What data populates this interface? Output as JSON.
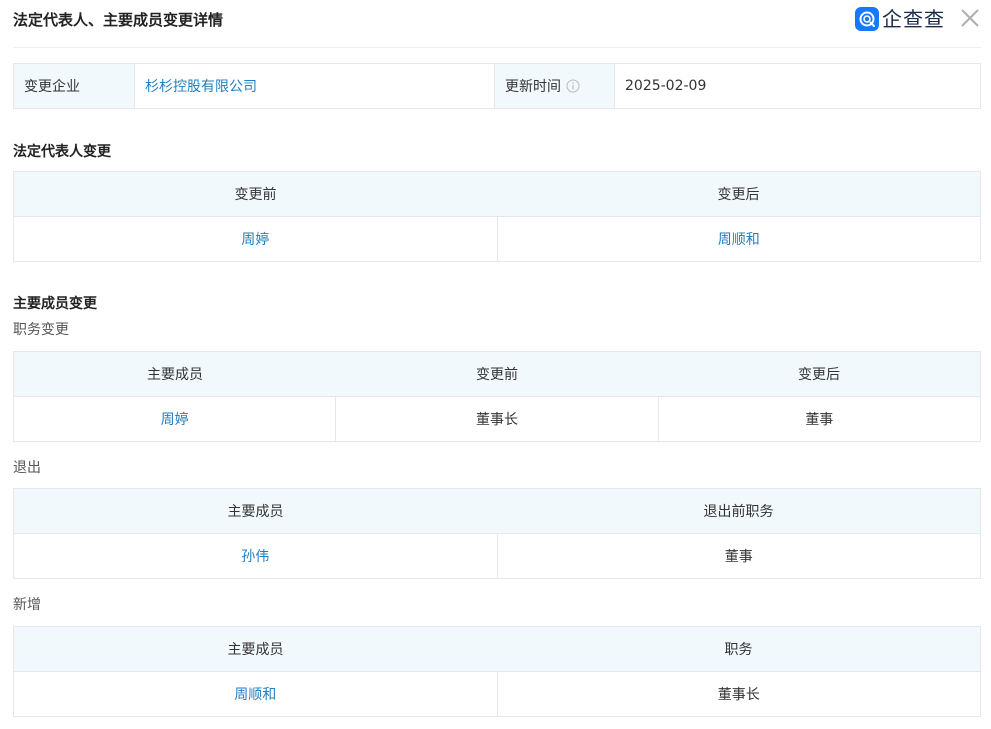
{
  "header": {
    "title": "法定代表人、主要成员变更详情",
    "logo_text": "企查查",
    "brand_color": "#1677ff"
  },
  "info": {
    "company_label": "变更企业",
    "company_value": "杉杉控股有限公司",
    "update_label": "更新时间",
    "update_value": "2025-02-09"
  },
  "legal_rep": {
    "section_title": "法定代表人变更",
    "headers": [
      "变更前",
      "变更后"
    ],
    "row": [
      "周婷",
      "周顺和"
    ]
  },
  "members": {
    "section_title": "主要成员变更",
    "position_change": {
      "title": "职务变更",
      "headers": [
        "主要成员",
        "变更前",
        "变更后"
      ],
      "row": [
        "周婷",
        "董事长",
        "董事"
      ]
    },
    "exit": {
      "title": "退出",
      "headers": [
        "主要成员",
        "退出前职务"
      ],
      "row": [
        "孙伟",
        "董事"
      ]
    },
    "added": {
      "title": "新增",
      "headers": [
        "主要成员",
        "职务"
      ],
      "row": [
        "周顺和",
        "董事长"
      ]
    }
  },
  "colors": {
    "link": "#1f7fc1",
    "header_bg": "#f2f9fc",
    "border": "#e4e8ee"
  }
}
